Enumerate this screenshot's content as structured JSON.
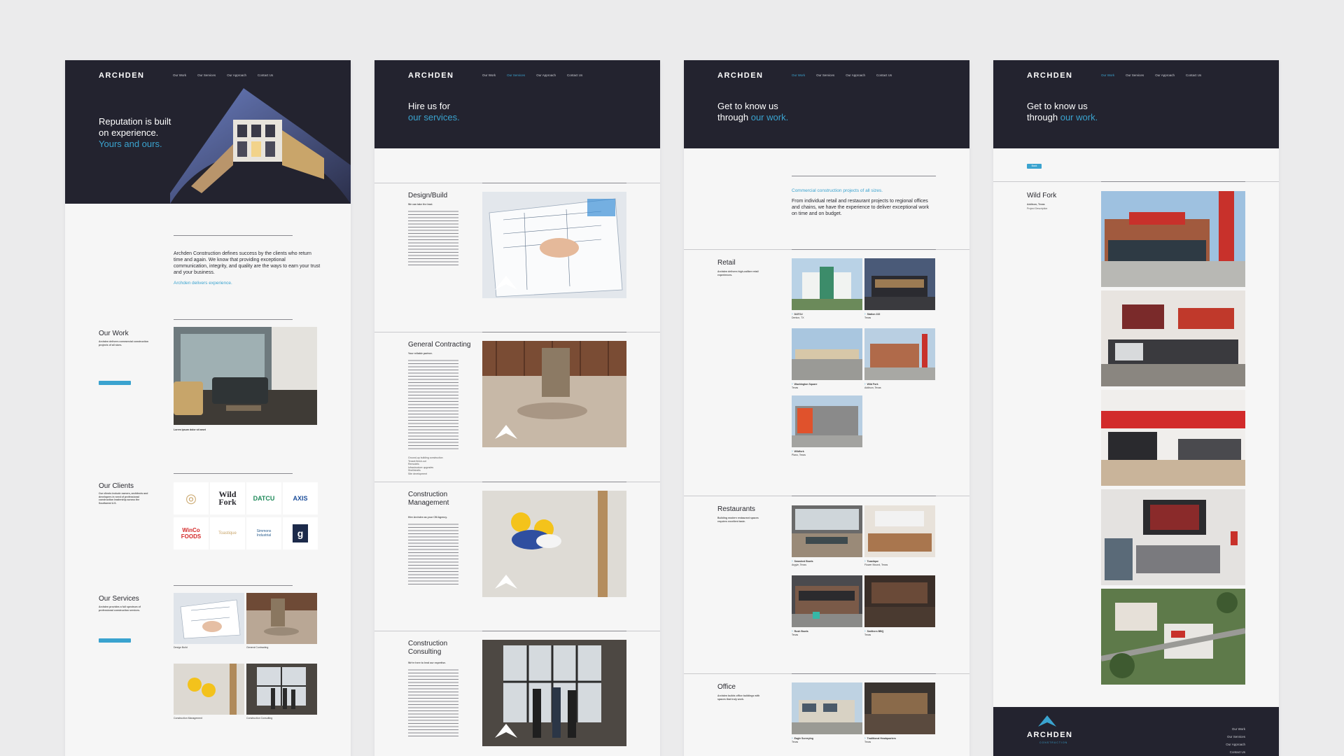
{
  "brand": "ARCHDEN",
  "nav": [
    "Our Work",
    "Our Services",
    "Our Approach",
    "Contact Us"
  ],
  "p1": {
    "hero_line1": "Reputation is built",
    "hero_line2": "on experience.",
    "hero_line3": "Yours and ours.",
    "intro": "Archden Construction defines success by the clients who return time and again. We know that providing exceptional communication, integrity, and quality are the ways to earn your trust and your business.",
    "intro_link": "Archden delivers experience.",
    "work_title": "Our Work",
    "work_sub": "Archden delivers commercial construction projects of all sizes.",
    "work_caption": "Lorem ipsum dolor sit amet",
    "clients_title": "Our Clients",
    "clients_sub": "Our clients include owners, architects and developers in need of professional construction leadership across the Southwest U.S.",
    "client_logos": [
      "Wild Fork",
      "DATCU",
      "AXIS",
      "WinCo FOODS",
      "Toastique",
      "Simmons Industrial",
      "g"
    ],
    "services_title": "Our Services",
    "services_sub": "Archden provides a full spectrum of professional construction services.",
    "service_caps": [
      "Design Build",
      "General Contracting",
      "Construction Management",
      "Construction Consulting"
    ]
  },
  "p2": {
    "hero_line1": "Hire us for",
    "hero_line2": "our services.",
    "sections": [
      {
        "title": "Design/Build",
        "sub": "We can take the lead."
      },
      {
        "title": "General Contracting",
        "sub": "Your reliable partner."
      },
      {
        "title": "Construction Management",
        "sub": "Hire Archden as your CM Agency."
      },
      {
        "title": "Construction Consulting",
        "sub": "We're here to lend our expertise."
      }
    ],
    "gc_list": [
      "Ground-up building construction",
      "Tenant finish-out",
      "Remodels",
      "Infrastructure upgrades",
      "Shell/shells",
      "Site development"
    ]
  },
  "p3": {
    "hero_line1": "Get to know us",
    "hero_line2": "through",
    "hero_line2b": "our work.",
    "intro_head": "Commercial construction projects of all sizes.",
    "intro_text": "From individual retail and restaurant projects to regional offices and chains, we have the experience to deliver exceptional work on time and on budget.",
    "retail_title": "Retail",
    "retail_sub": "Archden delivers high-caliber retail experiences.",
    "retail_items": [
      {
        "name": "DATCU",
        "loc": "Denton, TX"
      },
      {
        "name": "Station 222",
        "loc": "Texas"
      },
      {
        "name": "Washington Square",
        "loc": "Texas"
      },
      {
        "name": "Wild Fork",
        "loc": "Addison, Texas"
      },
      {
        "name": "Wildfork",
        "loc": "Plano, Texas"
      }
    ],
    "rest_title": "Restaurants",
    "rest_sub": "Building modern restaurant spaces requires excellent taste.",
    "rest_items": [
      {
        "name": "Smashed Bowls",
        "loc": "Argyle, Texas"
      },
      {
        "name": "Toastique",
        "loc": "Flower Mound, Texas"
      },
      {
        "name": "Rush Bowls",
        "loc": "Texas"
      },
      {
        "name": "Smithers BBQ",
        "loc": "Texas"
      }
    ],
    "office_title": "Office",
    "office_sub": "Archden builds office buildings with spaces that truly work.",
    "office_items": [
      {
        "name": "Eagle Surveying",
        "loc": "Texas"
      },
      {
        "name": "Traditional Headquarters",
        "loc": "Texas"
      }
    ]
  },
  "p4": {
    "hero_line1": "Get to know us",
    "hero_line2": "through",
    "hero_line2b": "our work.",
    "back_label": "Back",
    "project_title": "Wild Fork",
    "project_loc": "Addison, Texas",
    "project_desc": "Project Description",
    "footer_links": [
      "Our Work",
      "Our Services",
      "Our Approach",
      "Contact Us"
    ],
    "footer_sub": "CONSTRUCTION"
  }
}
